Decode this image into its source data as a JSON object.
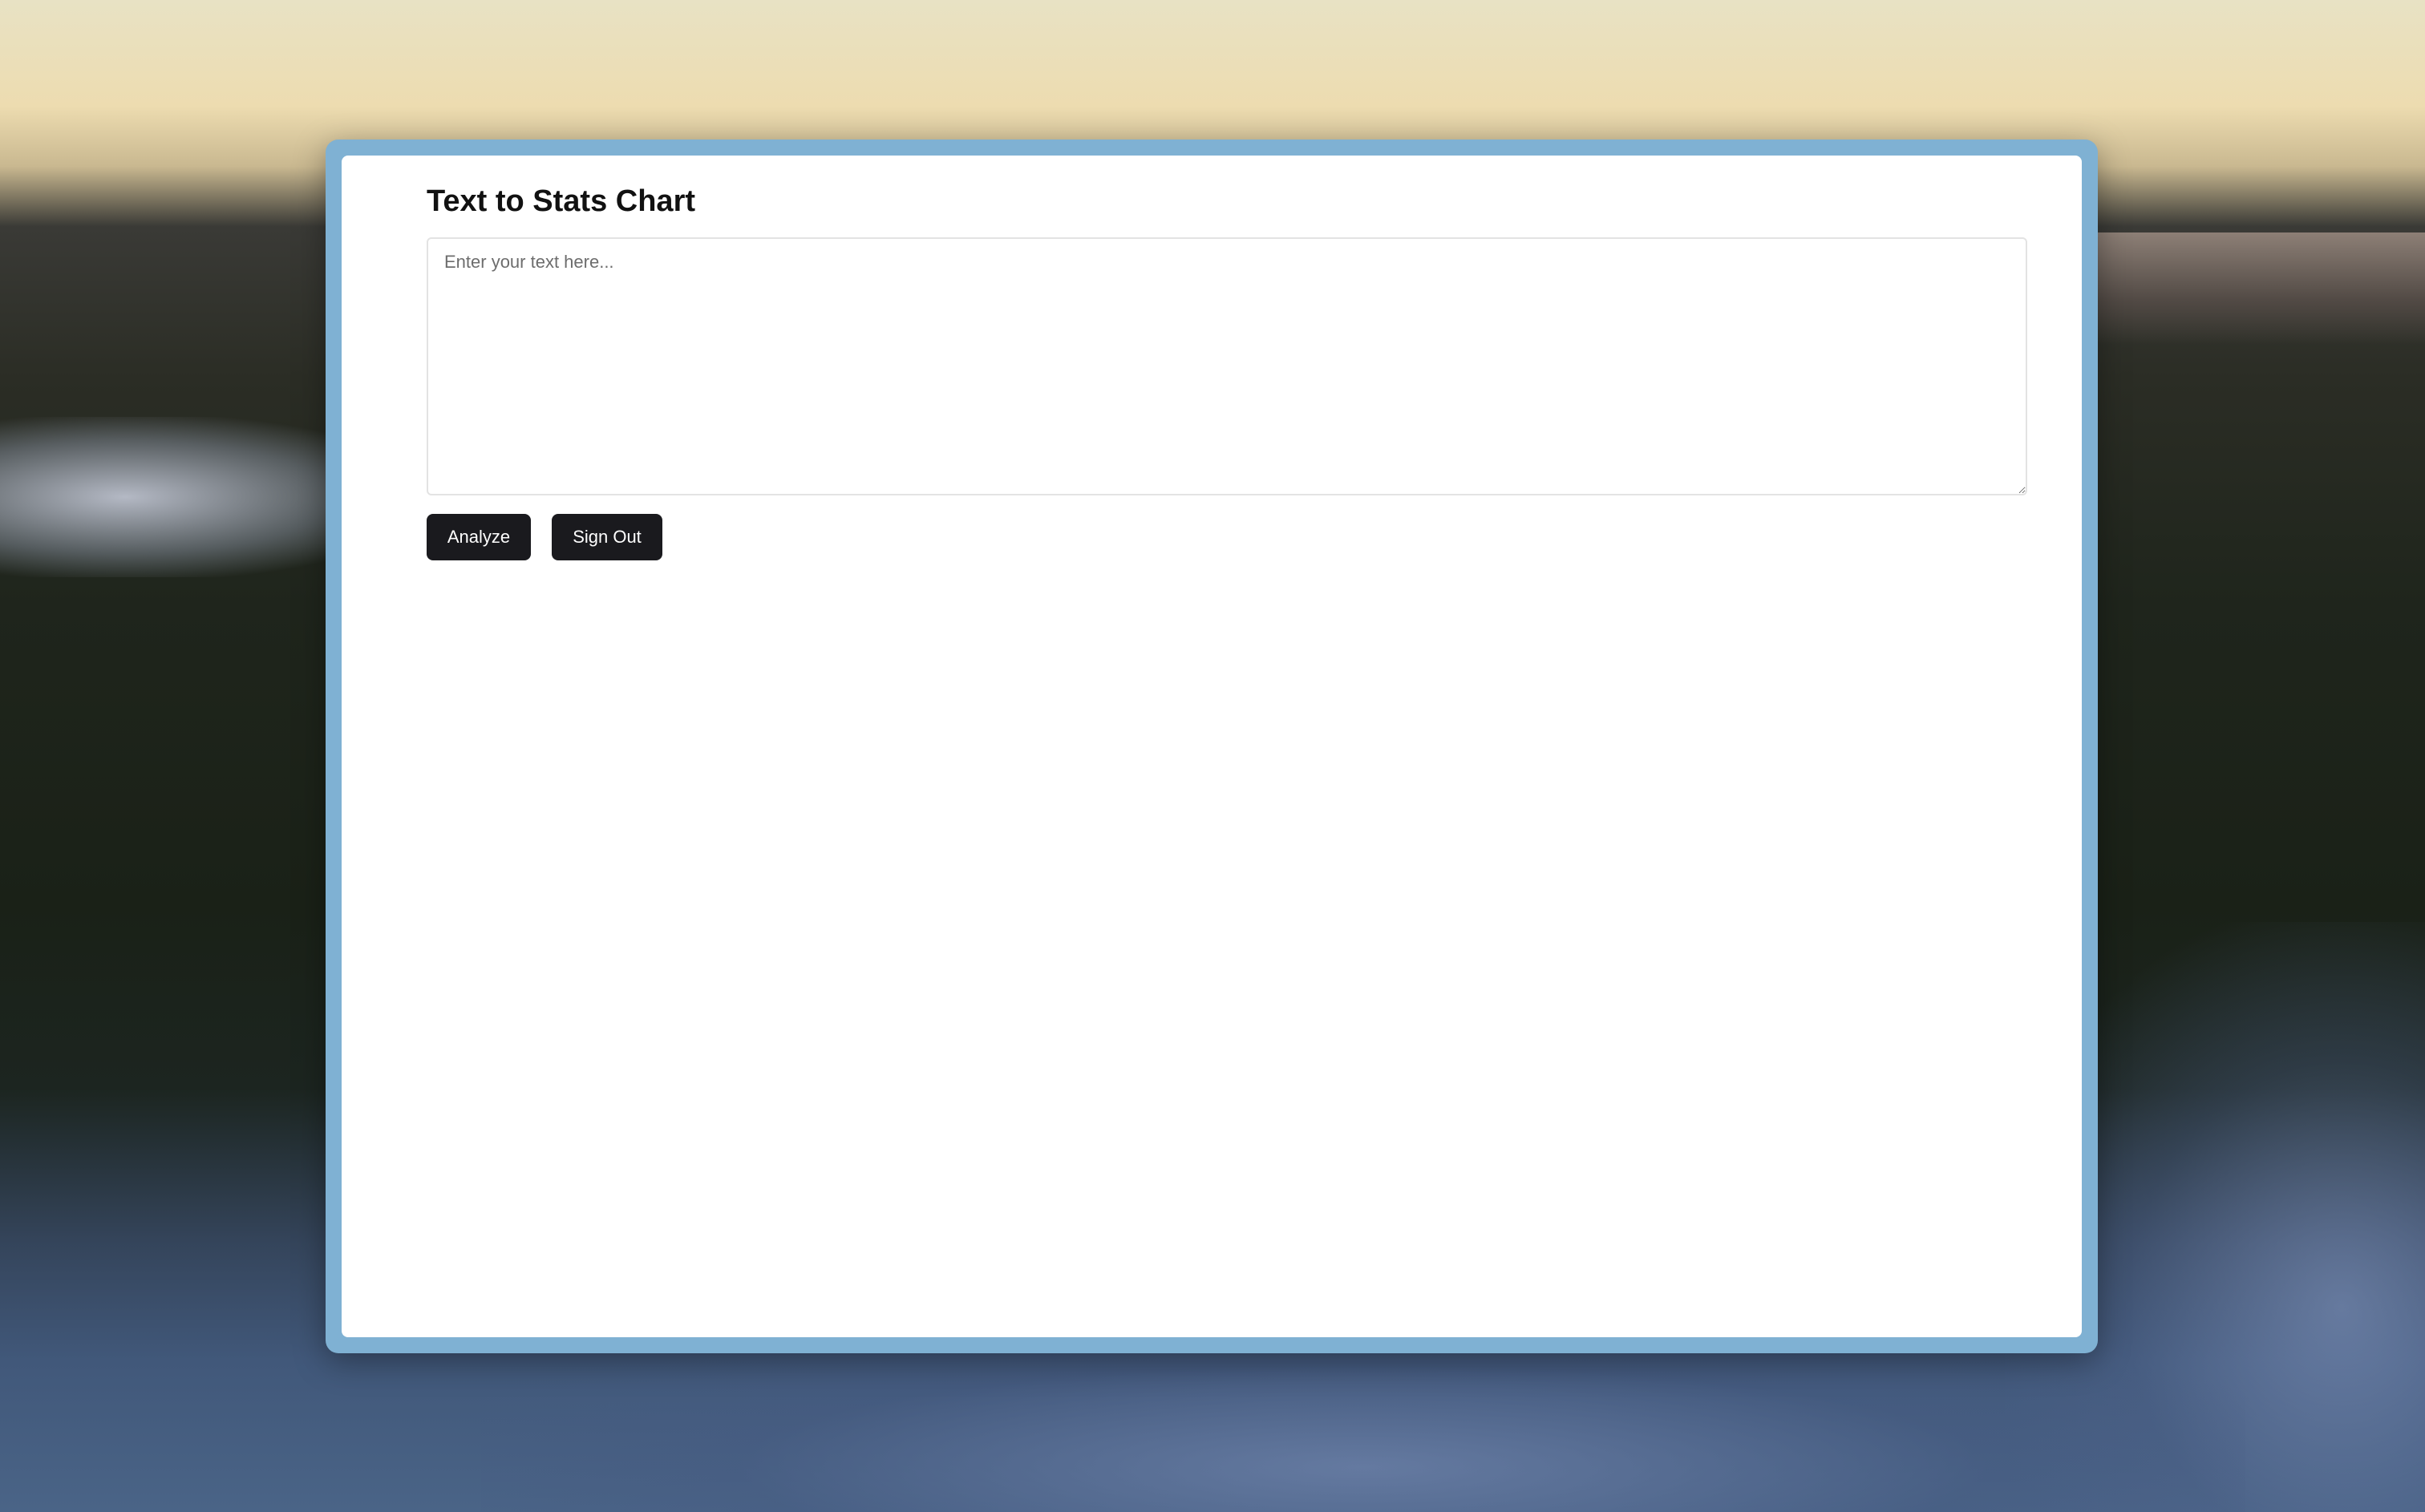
{
  "app": {
    "title": "Text to Stats Chart"
  },
  "input": {
    "placeholder": "Enter your text here...",
    "value": ""
  },
  "actions": {
    "analyze_label": "Analyze",
    "sign_out_label": "Sign Out"
  },
  "colors": {
    "window_frame": "#7fb1d3",
    "panel_background": "#ffffff",
    "button_background": "#1a1a1e",
    "button_text": "#ffffff",
    "title_text": "#111111"
  }
}
